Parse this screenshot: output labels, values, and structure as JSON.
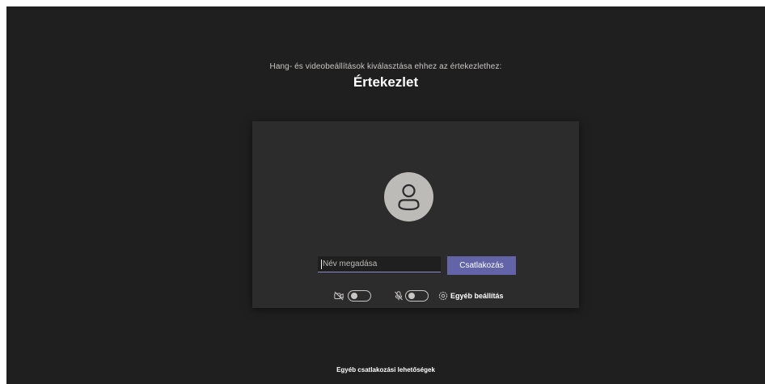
{
  "header": {
    "subtitle": "Hang- és videobeállítások kiválasztása ehhez az értekezlethez:",
    "title": "Értekezlet"
  },
  "prejoin": {
    "avatar_icon": "person-icon",
    "name_input": {
      "placeholder": "Név megadása",
      "value": ""
    },
    "join_label": "Csatlakozás",
    "controls": {
      "camera": {
        "icon": "camera-icon",
        "on": false
      },
      "microphone": {
        "icon": "microphone-icon",
        "on": false
      },
      "other_settings": {
        "icon": "gear-icon",
        "label": "Egyéb beállítás"
      }
    }
  },
  "footer": {
    "link": "Egyéb csatlakozási lehetőségek"
  },
  "colors": {
    "background": "#201f1f",
    "card": "#2d2c2c",
    "accent": "#6264a7",
    "avatar": "#bdbbb8",
    "text": "#ffffff"
  }
}
